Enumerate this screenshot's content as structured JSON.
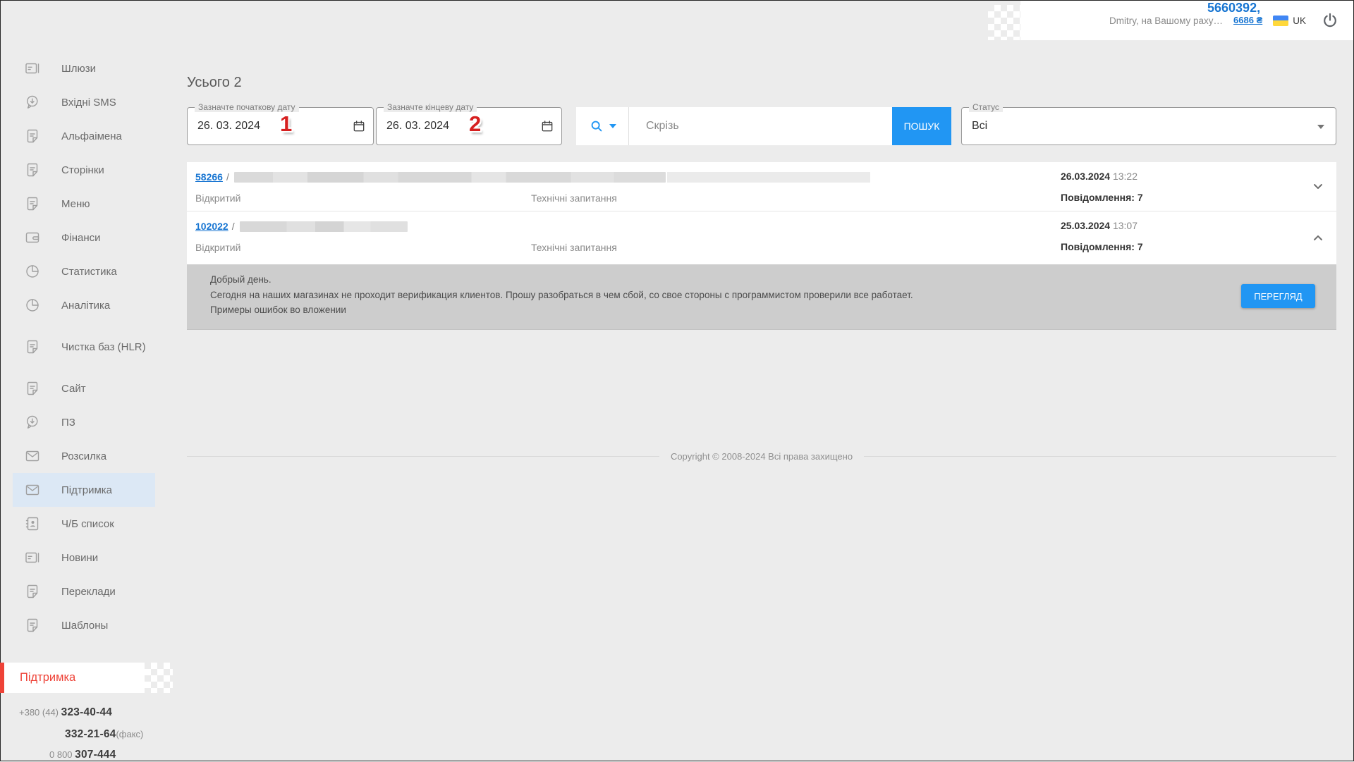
{
  "colors": {
    "accent_blue": "#2196f3",
    "link_blue": "#1976d2",
    "accent_red": "#ee4237",
    "annotation_red": "#d61f1f",
    "flag_blue": "#4086f4",
    "flag_yellow": "#ffd83b",
    "active_item_bg": "#dce8f5"
  },
  "header": {
    "user_greeting": "Dmitry, на Вашому раху…",
    "balance_main": "5660392,",
    "balance_fraction": "6686 ₴",
    "language": "UK"
  },
  "sidebar": {
    "items": [
      {
        "label": "Шлюзи",
        "icon": "gateway"
      },
      {
        "label": "Вхідні SMS",
        "icon": "incoming-sms"
      },
      {
        "label": "Альфаімена",
        "icon": "document"
      },
      {
        "label": "Сторінки",
        "icon": "document"
      },
      {
        "label": "Меню",
        "icon": "document"
      },
      {
        "label": "Фінанси",
        "icon": "wallet"
      },
      {
        "label": "Статистика",
        "icon": "pie-chart"
      },
      {
        "label": "Аналітика",
        "icon": "pie-chart"
      },
      {
        "label": "Чистка баз (HLR)",
        "icon": "document"
      },
      {
        "label": "Сайт",
        "icon": "document"
      },
      {
        "label": "ПЗ",
        "icon": "incoming-sms"
      },
      {
        "label": "Розсилка",
        "icon": "envelope"
      },
      {
        "label": "Підтримка",
        "icon": "envelope",
        "active": true
      },
      {
        "label": "Ч/Б список",
        "icon": "contacts"
      },
      {
        "label": "Новини",
        "icon": "gateway"
      },
      {
        "label": "Переклади",
        "icon": "document"
      },
      {
        "label": "Шаблоны",
        "icon": "document"
      }
    ],
    "support_label": "Підтримка",
    "phones": {
      "line1_prefix": "+380 (44) ",
      "line1_number": "323-40-44",
      "line2_number": "332-21-64",
      "line2_suffix": "(факс)",
      "line3_prefix": "0 800 ",
      "line3_number": "307-444"
    }
  },
  "main": {
    "total": "Усього 2",
    "id_separator": "/",
    "filters": {
      "date_from": {
        "label": "Зазначте початкову дату",
        "value": "26. 03. 2024",
        "annotation": "1"
      },
      "date_to": {
        "label": "Зазначте кінцеву дату",
        "value": "26. 03. 2024",
        "annotation": "2"
      },
      "search": {
        "placeholder": "Скрізь",
        "button": "ПОШУК"
      },
      "status": {
        "label": "Статус",
        "value": "Всі"
      }
    },
    "tickets": [
      {
        "id": "58266",
        "status": "Відкритий",
        "category": "Технічні запитання",
        "date": "26.03.2024",
        "time": "13:22",
        "messages": "Повідомлення: 7"
      },
      {
        "id": "102022",
        "status": "Відкритий",
        "category": "Технічні запитання",
        "date": "25.03.2024",
        "time": "13:07",
        "messages": "Повідомлення: 7",
        "message_lines": [
          "Добрый день.",
          "Сегодня на наших магазинах не проходит верификация клиентов. Прошу разобраться в чем сбой, со свое стороны с программистом проверили все работает.",
          "Примеры ошибок во вложении"
        ],
        "view_button": "ПЕРЕГЛЯД"
      }
    ],
    "copyright": "Copyright © 2008-2024 Всі права захищено"
  }
}
